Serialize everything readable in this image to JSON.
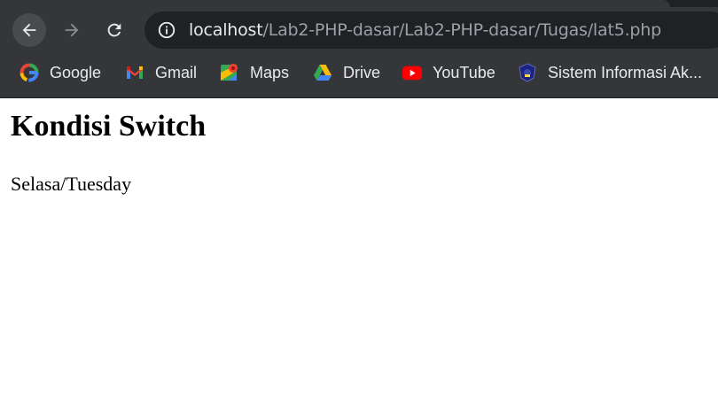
{
  "browser": {
    "url_host": "localhost",
    "url_path": "/Lab2-PHP-dasar/Lab2-PHP-dasar/Tugas/lat5.php"
  },
  "bookmarks": [
    {
      "label": "Google",
      "icon": "google-icon"
    },
    {
      "label": "Gmail",
      "icon": "gmail-icon"
    },
    {
      "label": "Maps",
      "icon": "maps-icon"
    },
    {
      "label": "Drive",
      "icon": "drive-icon"
    },
    {
      "label": "YouTube",
      "icon": "youtube-icon"
    },
    {
      "label": "Sistem Informasi Ak...",
      "icon": "university-logo-icon"
    }
  ],
  "page": {
    "heading": "Kondisi Switch",
    "text": "Selasa/Tuesday"
  },
  "colors": {
    "chrome_bg": "#35363a",
    "omnibox_bg": "#202124",
    "url_host": "#e8eaed",
    "url_path": "#9aa0a6"
  }
}
